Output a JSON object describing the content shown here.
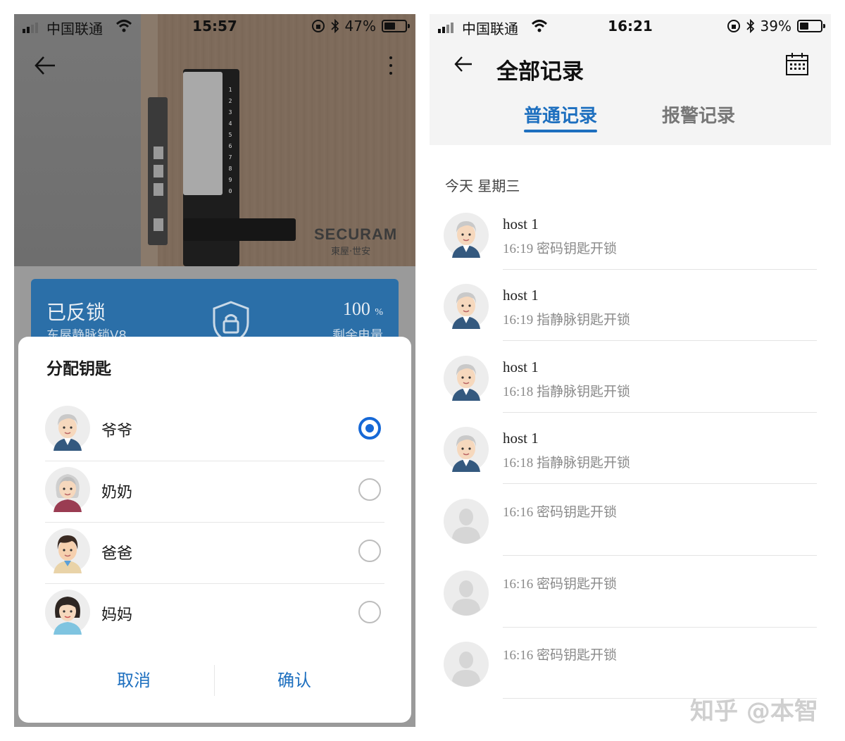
{
  "left": {
    "status": {
      "carrier": "中国联通",
      "time": "15:57",
      "battery": "47%",
      "battery_level": 0.47
    },
    "photo": {
      "brand": "SECURAM",
      "brand_sub": "東屋·世安"
    },
    "card": {
      "state": "已反锁",
      "device": "东屋静脉锁V8",
      "battery_value": "100",
      "battery_unit": "%",
      "battery_label": "剩余电量"
    },
    "dialog": {
      "title": "分配钥匙",
      "options": [
        {
          "name": "爷爷",
          "selected": true
        },
        {
          "name": "奶奶",
          "selected": false
        },
        {
          "name": "爸爸",
          "selected": false
        },
        {
          "name": "妈妈",
          "selected": false
        }
      ],
      "cancel": "取消",
      "confirm": "确认"
    }
  },
  "right": {
    "status": {
      "carrier": "中国联通",
      "time": "16:21",
      "battery": "39%",
      "battery_level": 0.39
    },
    "title": "全部记录",
    "tabs": {
      "normal": "普通记录",
      "alarm": "报警记录"
    },
    "date_label": "今天 星期三",
    "records": [
      {
        "user": "host 1",
        "action": "16:19 密码钥匙开锁"
      },
      {
        "user": "host 1",
        "action": "16:19 指静脉钥匙开锁"
      },
      {
        "user": "host 1",
        "action": "16:18 指静脉钥匙开锁"
      },
      {
        "user": "host 1",
        "action": "16:18 指静脉钥匙开锁"
      },
      {
        "user": "",
        "action": "16:16 密码钥匙开锁"
      },
      {
        "user": "",
        "action": "16:16 密码钥匙开锁"
      },
      {
        "user": "",
        "action": "16:16 密码钥匙开锁"
      }
    ]
  },
  "watermark": "知乎 @本智"
}
